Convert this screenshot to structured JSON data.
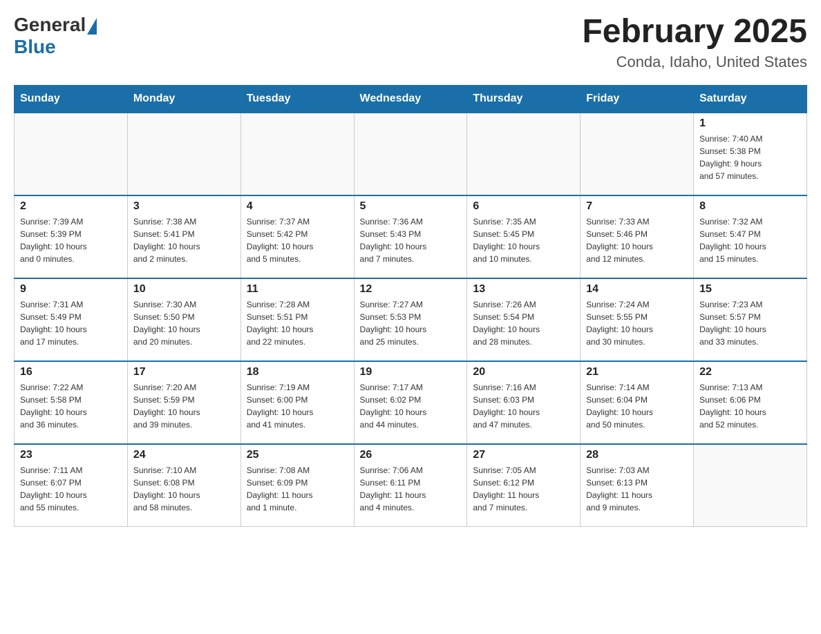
{
  "header": {
    "logo_general": "General",
    "logo_blue": "Blue",
    "title": "February 2025",
    "subtitle": "Conda, Idaho, United States"
  },
  "days_of_week": [
    "Sunday",
    "Monday",
    "Tuesday",
    "Wednesday",
    "Thursday",
    "Friday",
    "Saturday"
  ],
  "weeks": [
    {
      "days": [
        {
          "number": "",
          "info": ""
        },
        {
          "number": "",
          "info": ""
        },
        {
          "number": "",
          "info": ""
        },
        {
          "number": "",
          "info": ""
        },
        {
          "number": "",
          "info": ""
        },
        {
          "number": "",
          "info": ""
        },
        {
          "number": "1",
          "info": "Sunrise: 7:40 AM\nSunset: 5:38 PM\nDaylight: 9 hours\nand 57 minutes."
        }
      ]
    },
    {
      "days": [
        {
          "number": "2",
          "info": "Sunrise: 7:39 AM\nSunset: 5:39 PM\nDaylight: 10 hours\nand 0 minutes."
        },
        {
          "number": "3",
          "info": "Sunrise: 7:38 AM\nSunset: 5:41 PM\nDaylight: 10 hours\nand 2 minutes."
        },
        {
          "number": "4",
          "info": "Sunrise: 7:37 AM\nSunset: 5:42 PM\nDaylight: 10 hours\nand 5 minutes."
        },
        {
          "number": "5",
          "info": "Sunrise: 7:36 AM\nSunset: 5:43 PM\nDaylight: 10 hours\nand 7 minutes."
        },
        {
          "number": "6",
          "info": "Sunrise: 7:35 AM\nSunset: 5:45 PM\nDaylight: 10 hours\nand 10 minutes."
        },
        {
          "number": "7",
          "info": "Sunrise: 7:33 AM\nSunset: 5:46 PM\nDaylight: 10 hours\nand 12 minutes."
        },
        {
          "number": "8",
          "info": "Sunrise: 7:32 AM\nSunset: 5:47 PM\nDaylight: 10 hours\nand 15 minutes."
        }
      ]
    },
    {
      "days": [
        {
          "number": "9",
          "info": "Sunrise: 7:31 AM\nSunset: 5:49 PM\nDaylight: 10 hours\nand 17 minutes."
        },
        {
          "number": "10",
          "info": "Sunrise: 7:30 AM\nSunset: 5:50 PM\nDaylight: 10 hours\nand 20 minutes."
        },
        {
          "number": "11",
          "info": "Sunrise: 7:28 AM\nSunset: 5:51 PM\nDaylight: 10 hours\nand 22 minutes."
        },
        {
          "number": "12",
          "info": "Sunrise: 7:27 AM\nSunset: 5:53 PM\nDaylight: 10 hours\nand 25 minutes."
        },
        {
          "number": "13",
          "info": "Sunrise: 7:26 AM\nSunset: 5:54 PM\nDaylight: 10 hours\nand 28 minutes."
        },
        {
          "number": "14",
          "info": "Sunrise: 7:24 AM\nSunset: 5:55 PM\nDaylight: 10 hours\nand 30 minutes."
        },
        {
          "number": "15",
          "info": "Sunrise: 7:23 AM\nSunset: 5:57 PM\nDaylight: 10 hours\nand 33 minutes."
        }
      ]
    },
    {
      "days": [
        {
          "number": "16",
          "info": "Sunrise: 7:22 AM\nSunset: 5:58 PM\nDaylight: 10 hours\nand 36 minutes."
        },
        {
          "number": "17",
          "info": "Sunrise: 7:20 AM\nSunset: 5:59 PM\nDaylight: 10 hours\nand 39 minutes."
        },
        {
          "number": "18",
          "info": "Sunrise: 7:19 AM\nSunset: 6:00 PM\nDaylight: 10 hours\nand 41 minutes."
        },
        {
          "number": "19",
          "info": "Sunrise: 7:17 AM\nSunset: 6:02 PM\nDaylight: 10 hours\nand 44 minutes."
        },
        {
          "number": "20",
          "info": "Sunrise: 7:16 AM\nSunset: 6:03 PM\nDaylight: 10 hours\nand 47 minutes."
        },
        {
          "number": "21",
          "info": "Sunrise: 7:14 AM\nSunset: 6:04 PM\nDaylight: 10 hours\nand 50 minutes."
        },
        {
          "number": "22",
          "info": "Sunrise: 7:13 AM\nSunset: 6:06 PM\nDaylight: 10 hours\nand 52 minutes."
        }
      ]
    },
    {
      "days": [
        {
          "number": "23",
          "info": "Sunrise: 7:11 AM\nSunset: 6:07 PM\nDaylight: 10 hours\nand 55 minutes."
        },
        {
          "number": "24",
          "info": "Sunrise: 7:10 AM\nSunset: 6:08 PM\nDaylight: 10 hours\nand 58 minutes."
        },
        {
          "number": "25",
          "info": "Sunrise: 7:08 AM\nSunset: 6:09 PM\nDaylight: 11 hours\nand 1 minute."
        },
        {
          "number": "26",
          "info": "Sunrise: 7:06 AM\nSunset: 6:11 PM\nDaylight: 11 hours\nand 4 minutes."
        },
        {
          "number": "27",
          "info": "Sunrise: 7:05 AM\nSunset: 6:12 PM\nDaylight: 11 hours\nand 7 minutes."
        },
        {
          "number": "28",
          "info": "Sunrise: 7:03 AM\nSunset: 6:13 PM\nDaylight: 11 hours\nand 9 minutes."
        },
        {
          "number": "",
          "info": ""
        }
      ]
    }
  ]
}
